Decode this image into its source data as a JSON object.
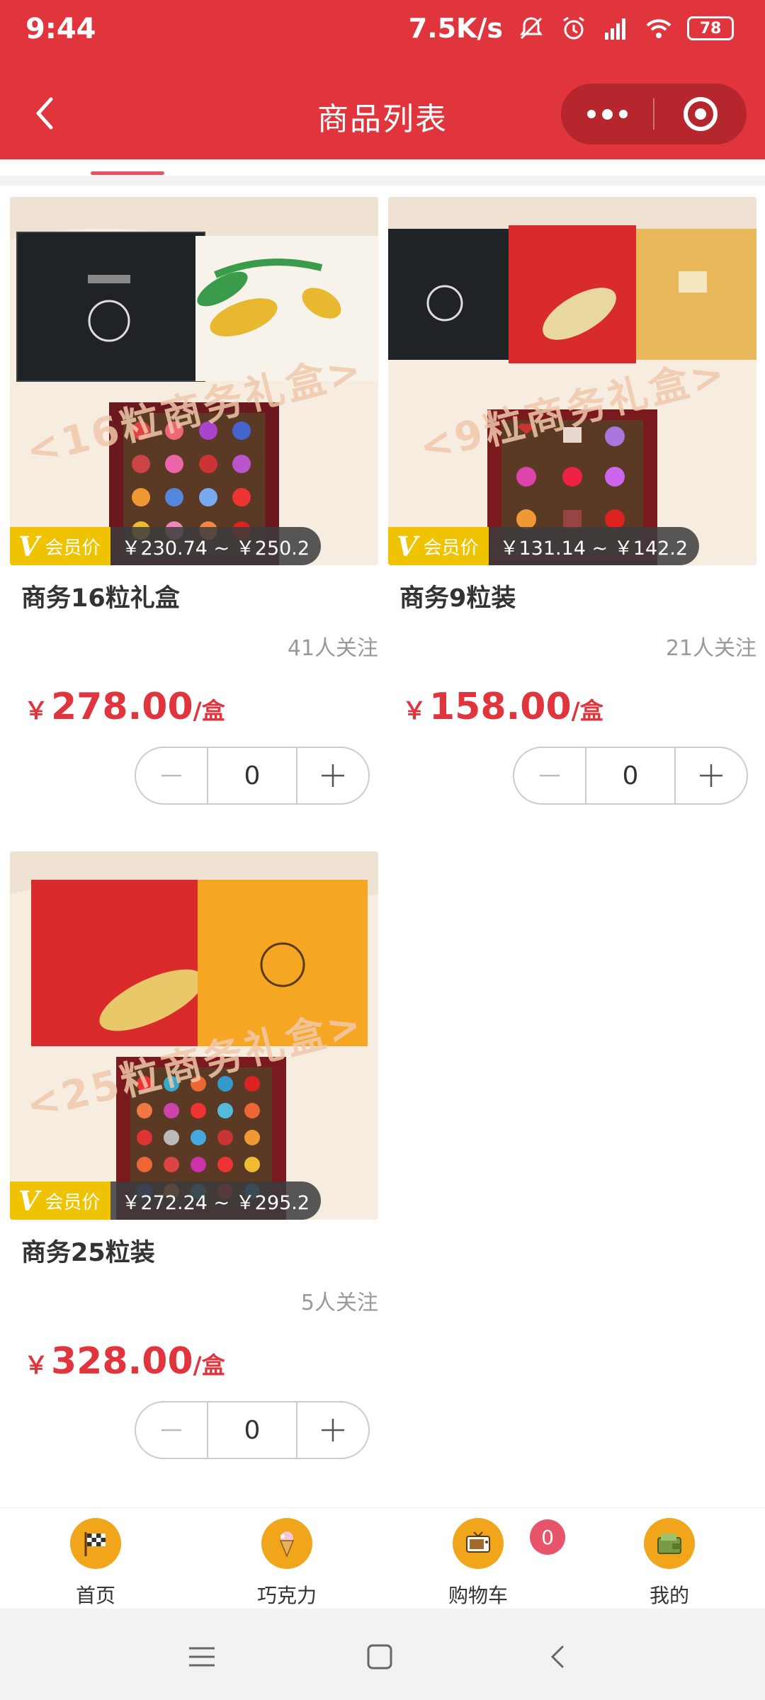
{
  "status_bar": {
    "time": "9:44",
    "network_speed": "7.5K/s",
    "battery": "78"
  },
  "nav": {
    "title": "商品列表"
  },
  "products": [
    {
      "name": "商务16粒礼盒",
      "image_banner": "<16粒商务礼盒>",
      "member_label": "会员价",
      "member_v": "V",
      "member_range": "￥230.74 ~ ￥250.2",
      "followers": "41人关注",
      "currency": "￥",
      "price": "278.00",
      "unit": "/盒",
      "quantity": "0"
    },
    {
      "name": "商务9粒装",
      "image_banner": "<9粒商务礼盒>",
      "member_label": "会员价",
      "member_v": "V",
      "member_range": "￥131.14 ~ ￥142.2",
      "followers": "21人关注",
      "currency": "￥",
      "price": "158.00",
      "unit": "/盒",
      "quantity": "0"
    },
    {
      "name": "商务25粒装",
      "image_banner": "<25粒商务礼盒>",
      "member_label": "会员价",
      "member_v": "V",
      "member_range": "￥272.24 ~ ￥295.2",
      "followers": "5人关注",
      "currency": "￥",
      "price": "328.00",
      "unit": "/盒",
      "quantity": "0"
    }
  ],
  "tabbar": {
    "items": [
      {
        "label": "首页",
        "icon": "checkered-flag-icon"
      },
      {
        "label": "巧克力",
        "icon": "ice-cream-icon"
      },
      {
        "label": "购物车",
        "icon": "tv-icon"
      },
      {
        "label": "我的",
        "icon": "wallet-icon"
      }
    ],
    "cart_count": "0"
  },
  "colors": {
    "brand_red": "#e1353e",
    "price_red": "#e1353e",
    "member_gold": "#f0c300",
    "tab_orange": "#f0a51a"
  }
}
